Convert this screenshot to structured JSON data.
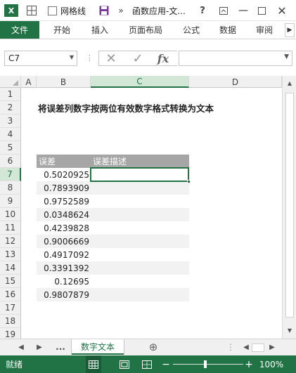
{
  "titlebar": {
    "logo_text": "X",
    "gridline_label": "网格线",
    "more": "»",
    "window_title": "函数应用-文...",
    "help": "?",
    "minimize": "—",
    "close": "✕"
  },
  "ribbon": {
    "tabs": [
      "文件",
      "开始",
      "插入",
      "页面布局",
      "公式",
      "数据",
      "审阅"
    ],
    "scroll": "▶"
  },
  "formula_bar": {
    "name_box": "C7",
    "name_arrow": "▼",
    "separator": "⋮",
    "cancel": "✕",
    "enter": "✓",
    "fx": "fx",
    "value": "",
    "expand": "▼"
  },
  "columns": [
    "A",
    "B",
    "C",
    "D"
  ],
  "rows": [
    "1",
    "2",
    "3",
    "4",
    "5",
    "6",
    "7",
    "8",
    "9",
    "10",
    "11",
    "12",
    "13",
    "14",
    "15",
    "16",
    "17",
    "18",
    "19"
  ],
  "sheet": {
    "title": "将误差列数字按两位有效数字格式转换为文本",
    "header_error": "误差",
    "header_desc": "误差描述",
    "errors": [
      "0.5020925",
      "0.7893909",
      "0.9752589",
      "0.0348624",
      "0.4239828",
      "0.9006669",
      "0.4917092",
      "0.3391392",
      "0.12695",
      "0.9807879"
    ]
  },
  "scroll": {
    "up": "▲",
    "down": "▼",
    "left": "◀",
    "right": "▶",
    "sep": "⋮"
  },
  "tabs_bar": {
    "prev": "◀",
    "next": "▶",
    "more": "...",
    "sheet_name": "数字文本",
    "add": "⊕"
  },
  "status": {
    "text": "就绪",
    "zoom_minus": "−",
    "zoom_plus": "+",
    "zoom_level": "100%"
  },
  "colors": {
    "excel_green": "#217346",
    "header_gray": "#a6a6a6",
    "zebra": "#f2f2f2"
  }
}
